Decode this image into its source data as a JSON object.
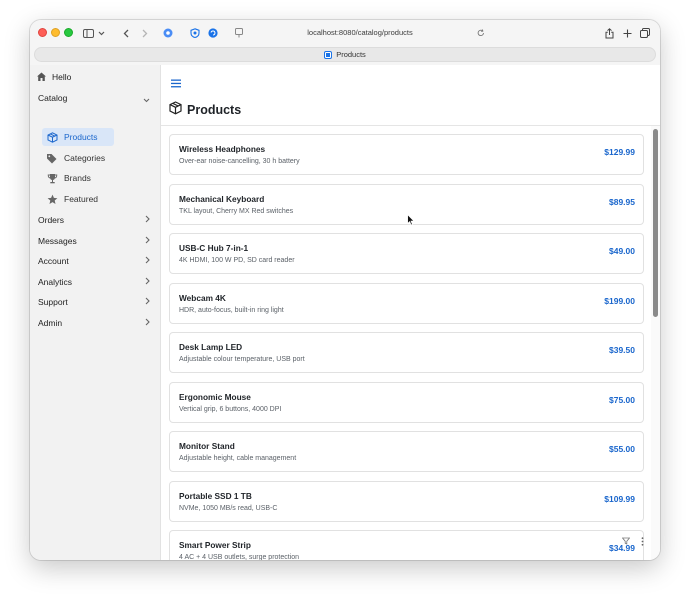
{
  "browser": {
    "url": "localhost:8080/catalog/products",
    "tab_title": "Products"
  },
  "sidebar": {
    "home_label": "Hello",
    "catalog": {
      "label": "Catalog",
      "items": [
        {
          "label": "Products",
          "icon": "box-icon",
          "active": true
        },
        {
          "label": "Categories",
          "icon": "tags-icon",
          "active": false
        },
        {
          "label": "Brands",
          "icon": "trophy-icon",
          "active": false
        },
        {
          "label": "Featured",
          "icon": "star-icon",
          "active": false
        }
      ]
    },
    "sections": [
      "Orders",
      "Messages",
      "Account",
      "Analytics",
      "Support",
      "Admin"
    ]
  },
  "main": {
    "title": "Products",
    "products": [
      {
        "name": "Wireless Headphones",
        "desc": "Over-ear noise-cancelling, 30 h battery",
        "price": "$129.99"
      },
      {
        "name": "Mechanical Keyboard",
        "desc": "TKL layout, Cherry MX Red switches",
        "price": "$89.95"
      },
      {
        "name": "USB-C Hub 7-in-1",
        "desc": "4K HDMI, 100 W PD, SD card reader",
        "price": "$49.00"
      },
      {
        "name": "Webcam 4K",
        "desc": "HDR, auto-focus, built-in ring light",
        "price": "$199.00"
      },
      {
        "name": "Desk Lamp LED",
        "desc": "Adjustable colour temperature, USB port",
        "price": "$39.50"
      },
      {
        "name": "Ergonomic Mouse",
        "desc": "Vertical grip, 6 buttons, 4000 DPI",
        "price": "$75.00"
      },
      {
        "name": "Monitor Stand",
        "desc": "Adjustable height, cable management",
        "price": "$55.00"
      },
      {
        "name": "Portable SSD 1 TB",
        "desc": "NVMe, 1050 MB/s read, USB-C",
        "price": "$109.99"
      },
      {
        "name": "Smart Power Strip",
        "desc": "4 AC + 4 USB outlets, surge protection",
        "price": "$34.99"
      }
    ]
  },
  "colors": {
    "accent": "#1a66cc",
    "active_bg": "#d9e6f8",
    "sidebar_bg": "#f2f2f2"
  }
}
